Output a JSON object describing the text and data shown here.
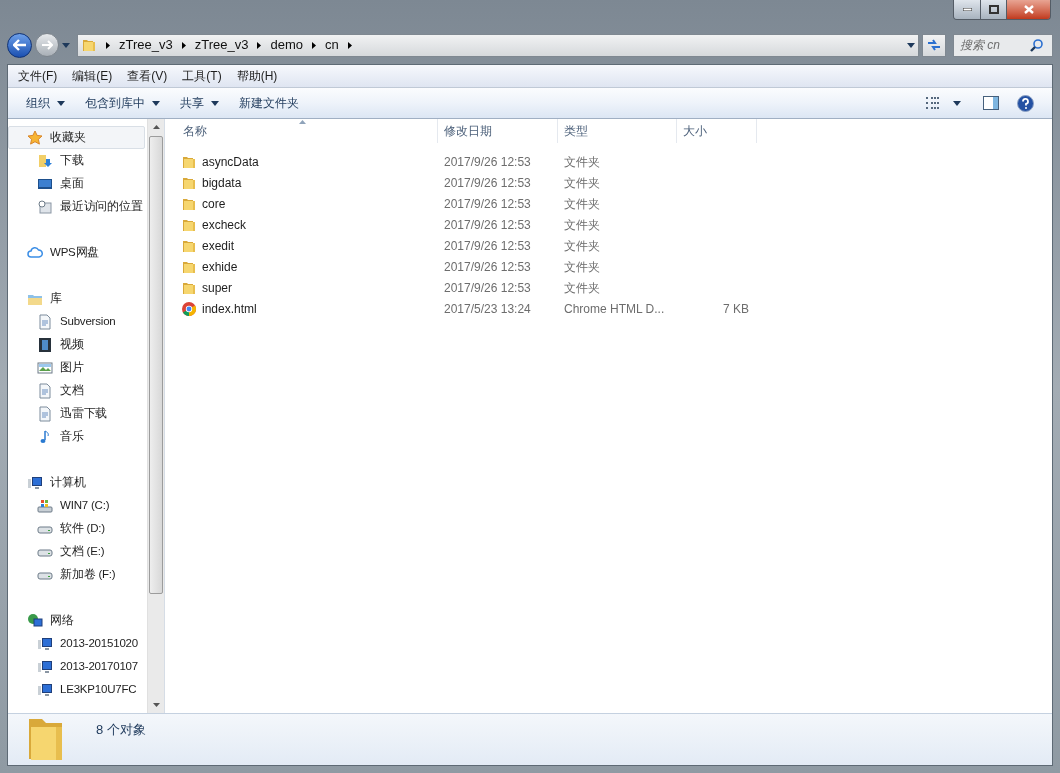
{
  "address_bar": {
    "path": [
      "zTree_v3",
      "zTree_v3",
      "demo",
      "cn"
    ]
  },
  "search": {
    "placeholder": "搜索 cn"
  },
  "menu_bar": [
    "文件(F)",
    "编辑(E)",
    "查看(V)",
    "工具(T)",
    "帮助(H)"
  ],
  "command_bar": [
    {
      "label": "组织",
      "dropdown": true
    },
    {
      "label": "包含到库中",
      "dropdown": true
    },
    {
      "label": "共享",
      "dropdown": true
    },
    {
      "label": "新建文件夹",
      "dropdown": false
    }
  ],
  "sidebar": {
    "groups": [
      {
        "label": "收藏夹",
        "kind": "star",
        "selected": true,
        "children": [
          {
            "label": "下载",
            "kind": "download",
            "selected": false
          },
          {
            "label": "桌面",
            "kind": "desktop",
            "selected": false
          },
          {
            "label": "最近访问的位置",
            "kind": "recent",
            "selected": false
          }
        ]
      },
      {
        "label": "WPS网盘",
        "kind": "cloud",
        "selected": false
      },
      {
        "label": "库",
        "kind": "library",
        "selected": false,
        "children": [
          {
            "label": "Subversion",
            "kind": "doc",
            "selected": false
          },
          {
            "label": "视频",
            "kind": "video",
            "selected": false
          },
          {
            "label": "图片",
            "kind": "image",
            "selected": false
          },
          {
            "label": "文档",
            "kind": "doc",
            "selected": false
          },
          {
            "label": "迅雷下载",
            "kind": "doc",
            "selected": false
          },
          {
            "label": "音乐",
            "kind": "music",
            "selected": false
          }
        ]
      },
      {
        "label": "计算机",
        "kind": "computer",
        "selected": false,
        "children": [
          {
            "label": "WIN7 (C:)",
            "kind": "sysdrive",
            "selected": false
          },
          {
            "label": "软件 (D:)",
            "kind": "drive",
            "selected": false
          },
          {
            "label": "文档 (E:)",
            "kind": "drive",
            "selected": false
          },
          {
            "label": "新加卷 (F:)",
            "kind": "drive",
            "selected": false
          }
        ]
      },
      {
        "label": "网络",
        "kind": "network",
        "selected": false,
        "children": [
          {
            "label": "2013-20151020",
            "kind": "computer",
            "selected": false
          },
          {
            "label": "2013-20170107",
            "kind": "computer",
            "selected": false
          },
          {
            "label": "LE3KP10U7FC",
            "kind": "computer",
            "selected": false
          }
        ]
      }
    ]
  },
  "table": {
    "columns": [
      "名称",
      "修改日期",
      "类型",
      "大小"
    ],
    "rows": [
      {
        "kind": "folder",
        "name": "asyncData",
        "modified": "2017/9/26 12:53",
        "type": "文件夹",
        "size": null
      },
      {
        "kind": "folder",
        "name": "bigdata",
        "modified": "2017/9/26 12:53",
        "type": "文件夹",
        "size": null
      },
      {
        "kind": "folder",
        "name": "core",
        "modified": "2017/9/26 12:53",
        "type": "文件夹",
        "size": null
      },
      {
        "kind": "folder",
        "name": "excheck",
        "modified": "2017/9/26 12:53",
        "type": "文件夹",
        "size": null
      },
      {
        "kind": "folder",
        "name": "exedit",
        "modified": "2017/9/26 12:53",
        "type": "文件夹",
        "size": null
      },
      {
        "kind": "folder",
        "name": "exhide",
        "modified": "2017/9/26 12:53",
        "type": "文件夹",
        "size": null
      },
      {
        "kind": "folder",
        "name": "super",
        "modified": "2017/9/26 12:53",
        "type": "文件夹",
        "size": null
      },
      {
        "kind": "chrome",
        "name": "index.html",
        "modified": "2017/5/23 13:24",
        "type": "Chrome HTML D...",
        "size": "7 KB"
      }
    ]
  },
  "status_bar": {
    "text": "8 个对象"
  }
}
